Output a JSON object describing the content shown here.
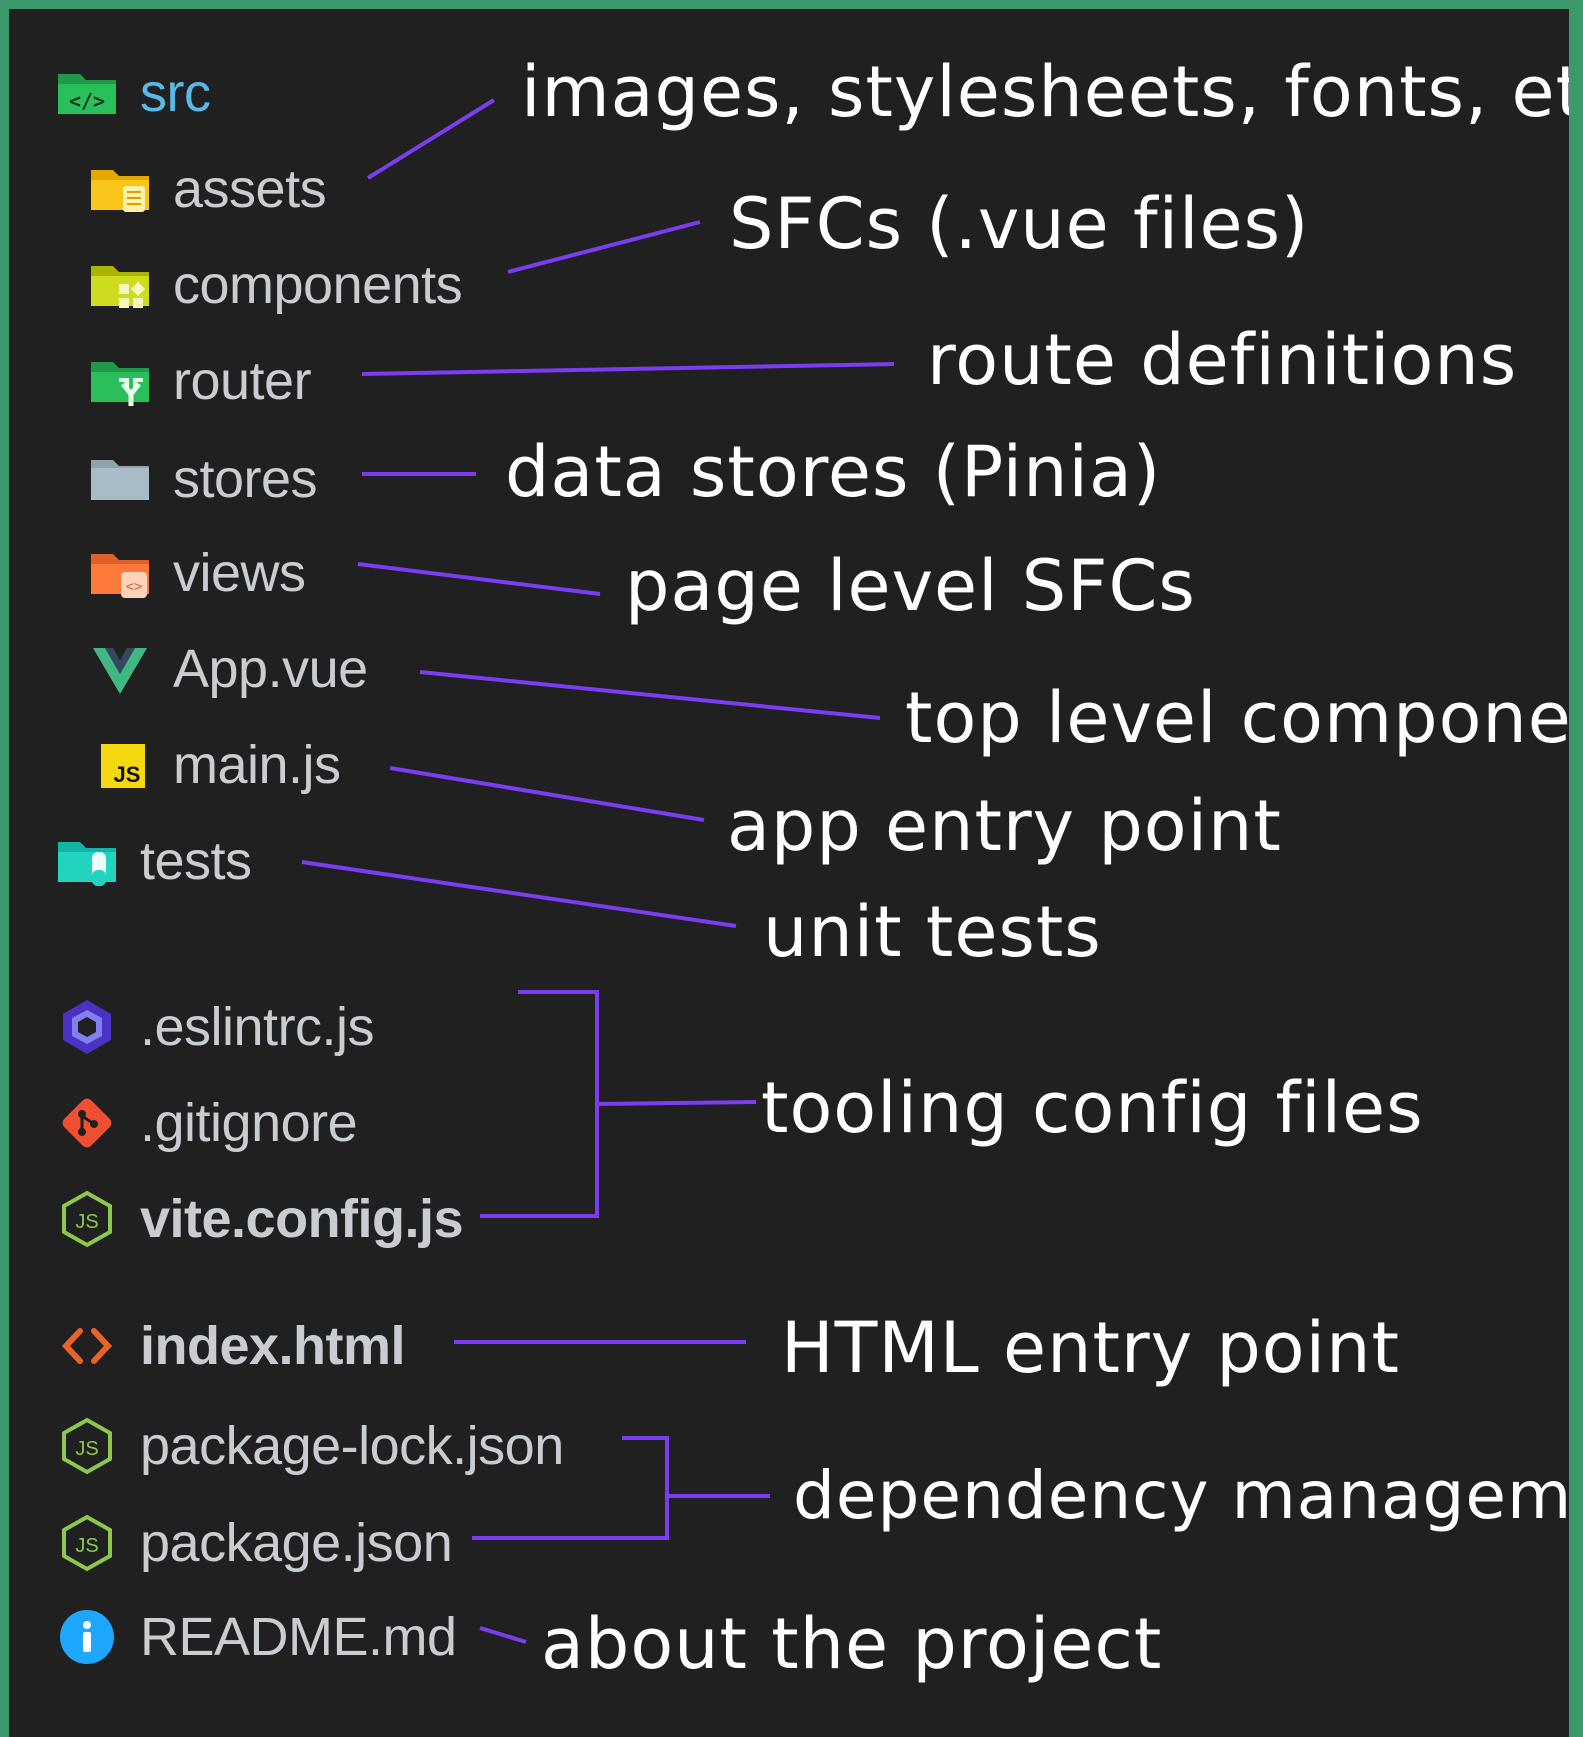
{
  "tree": {
    "root": {
      "label": "src",
      "icon": "folder-src-icon"
    },
    "src_children": [
      {
        "key": "assets",
        "label": "assets",
        "icon": "folder-assets-icon"
      },
      {
        "key": "components",
        "label": "components",
        "icon": "folder-components-icon"
      },
      {
        "key": "router",
        "label": "router",
        "icon": "folder-router-icon"
      },
      {
        "key": "stores",
        "label": "stores",
        "icon": "folder-icon"
      },
      {
        "key": "views",
        "label": "views",
        "icon": "folder-views-icon"
      },
      {
        "key": "app",
        "label": "App.vue",
        "icon": "vue-icon"
      },
      {
        "key": "main",
        "label": "main.js",
        "icon": "js-icon"
      }
    ],
    "top_level": [
      {
        "key": "tests",
        "label": "tests",
        "icon": "folder-tests-icon"
      },
      {
        "key": "eslint",
        "label": ".eslintrc.js",
        "icon": "eslint-icon"
      },
      {
        "key": "gitignore",
        "label": ".gitignore",
        "icon": "git-icon"
      },
      {
        "key": "vite",
        "label": "vite.config.js",
        "icon": "nodejs-icon"
      },
      {
        "key": "index",
        "label": "index.html",
        "icon": "html-icon"
      },
      {
        "key": "pkglock",
        "label": "package-lock.json",
        "icon": "nodejs-icon"
      },
      {
        "key": "pkg",
        "label": "package.json",
        "icon": "nodejs-icon"
      },
      {
        "key": "readme",
        "label": "README.md",
        "icon": "info-icon"
      }
    ]
  },
  "annotations": {
    "assets": "images, stylesheets, fonts, etc",
    "components": "SFCs (.vue files)",
    "router": "route definitions",
    "stores": "data stores (Pinia)",
    "views": "page level SFCs",
    "app": "top level component",
    "main": "app entry point",
    "tests": "unit tests",
    "tooling": "tooling config files",
    "index": "HTML entry point",
    "dependency": "dependency management",
    "readme": "about the project"
  },
  "colors": {
    "background": "#202020",
    "border": "#3a9a6a",
    "connector": "#7c3cf0",
    "annotation_text": "#ffffff",
    "tree_text": "#c9ccd1",
    "root_text": "#59b8e6"
  }
}
